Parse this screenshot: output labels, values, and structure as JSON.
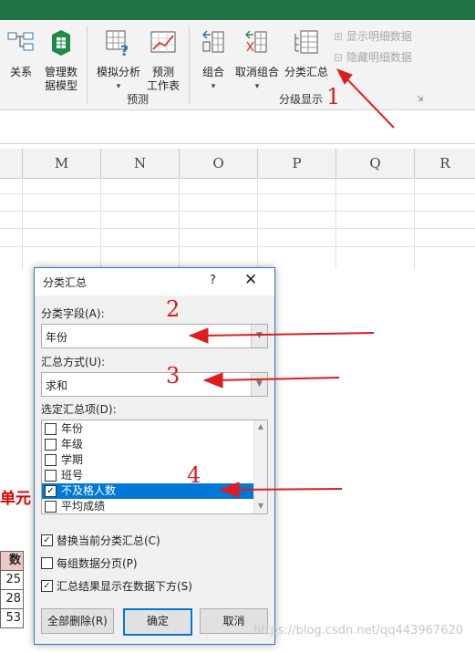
{
  "ribbon": {
    "buttons": [
      {
        "label1": "关系",
        "label2": ""
      },
      {
        "label1": "管理数",
        "label2": "据模型"
      },
      {
        "label1": "模拟分析",
        "label2": "▾"
      },
      {
        "label1": "预测",
        "label2": "工作表"
      },
      {
        "label1": "组合",
        "label2": "▾"
      },
      {
        "label1": "取消组合",
        "label2": "▾"
      },
      {
        "label1": "分类汇总",
        "label2": ""
      }
    ],
    "show_detail": "显示明细数据",
    "hide_detail": "隐藏明细数据",
    "group_forecast": "预测",
    "group_outline": "分级显示"
  },
  "columns": [
    "M",
    "N",
    "O",
    "P",
    "Q",
    "R"
  ],
  "sheet": {
    "red_text": "单元",
    "header_cell": "数",
    "cells": [
      "25",
      "28",
      "53"
    ]
  },
  "dialog": {
    "title": "分类汇总",
    "help": "?",
    "close": "✕",
    "field_label": "分类字段(A):",
    "field_value": "年份",
    "method_label": "汇总方式(U):",
    "method_value": "求和",
    "items_label": "选定汇总项(D):",
    "items": [
      {
        "label": "年份",
        "checked": false
      },
      {
        "label": "年级",
        "checked": false
      },
      {
        "label": "学期",
        "checked": false
      },
      {
        "label": "班号",
        "checked": false
      },
      {
        "label": "不及格人数",
        "checked": true
      },
      {
        "label": "平均成绩",
        "checked": false
      }
    ],
    "options": [
      {
        "label": "替换当前分类汇总(C)",
        "checked": true
      },
      {
        "label": "每组数据分页(P)",
        "checked": false
      },
      {
        "label": "汇总结果显示在数据下方(S)",
        "checked": true
      }
    ],
    "btn_remove_all": "全部删除(R)",
    "btn_ok": "确定",
    "btn_cancel": "取消"
  },
  "annotations": [
    "1",
    "2",
    "3",
    "4"
  ],
  "watermark": "https://blog.csdn.net/qq443967620",
  "colors": {
    "annotation": "#e01c1c",
    "selection": "#0078d7",
    "excel_green": "#217346"
  }
}
